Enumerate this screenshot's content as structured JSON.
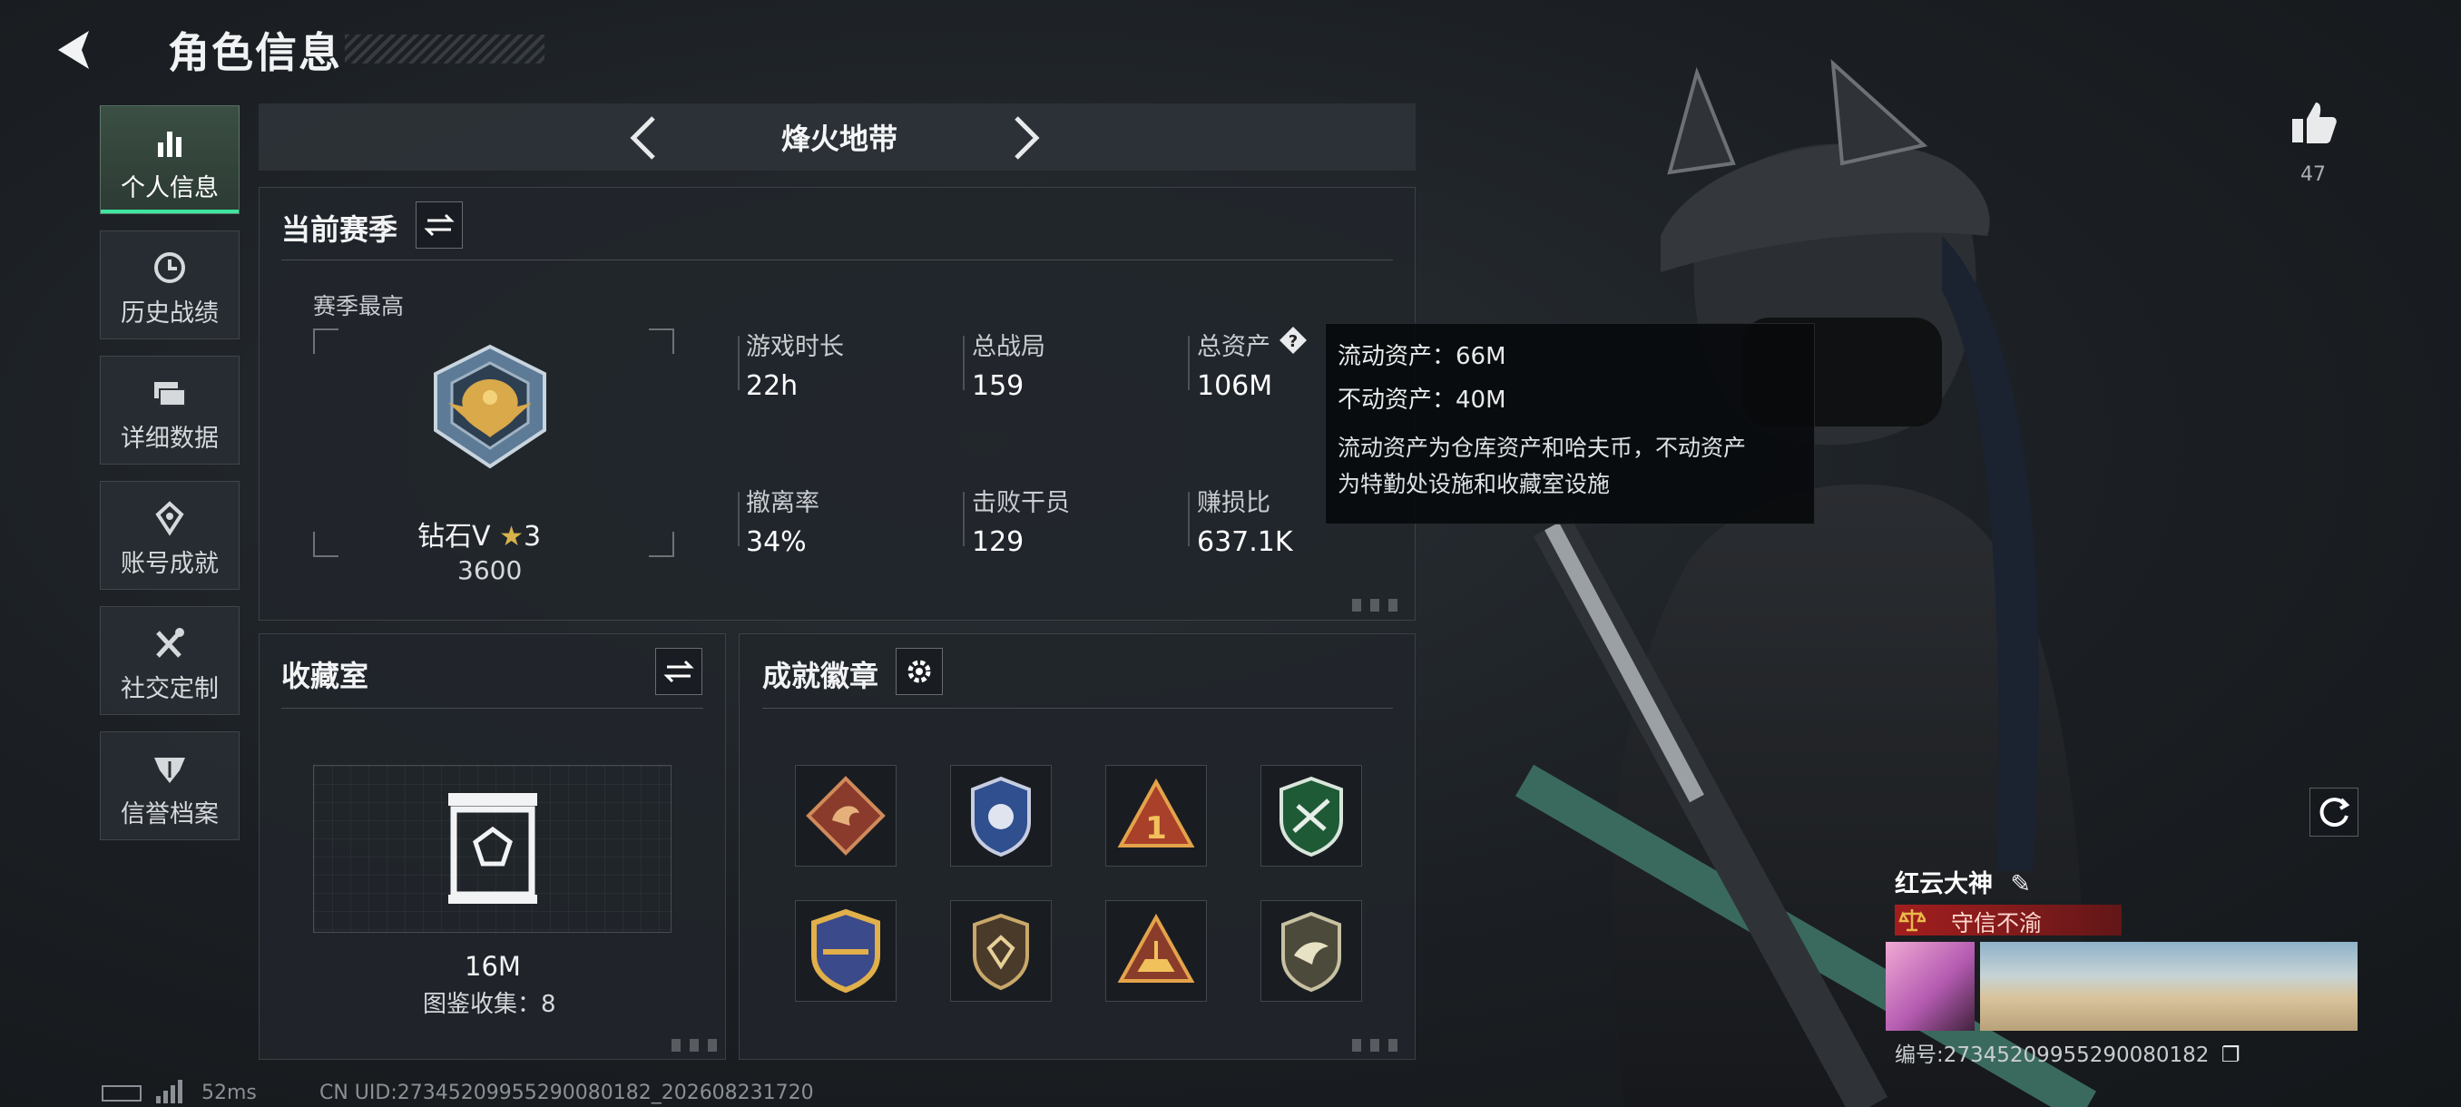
{
  "header": {
    "title": "角色信息"
  },
  "sidebar": {
    "items": [
      {
        "label": "个人信息",
        "icon": "bar-chart-icon",
        "active": true
      },
      {
        "label": "历史战绩",
        "icon": "clock-icon",
        "active": false
      },
      {
        "label": "详细数据",
        "icon": "folders-icon",
        "active": false
      },
      {
        "label": "账号成就",
        "icon": "achievement-icon",
        "active": false
      },
      {
        "label": "社交定制",
        "icon": "tools-icon",
        "active": false
      },
      {
        "label": "信誉档案",
        "icon": "shield-wings-icon",
        "active": false
      }
    ]
  },
  "mode": {
    "title": "烽火地带"
  },
  "season": {
    "title": "当前赛季",
    "best_label": "赛季最高",
    "rank_name": "钻石V",
    "rank_stars": "3",
    "rank_score": "3600",
    "stats": [
      {
        "label": "游戏时长",
        "value": "22h"
      },
      {
        "label": "总战局",
        "value": "159"
      },
      {
        "label": "总资产",
        "value": "106M"
      },
      {
        "label": "撤离率",
        "value": "34%"
      },
      {
        "label": "击败干员",
        "value": "129"
      },
      {
        "label": "赚损比",
        "value": "637.1K"
      }
    ]
  },
  "tooltip": {
    "liquid": "流动资产：66M",
    "fixed": "不动资产：40M",
    "desc_line1": "流动资产为仓库资产和哈夫币，不动资产",
    "desc_line2": "为特勤处设施和收藏室设施"
  },
  "collection": {
    "title": "收藏室",
    "value": "16M",
    "catalog": "图鉴收集：8"
  },
  "achievements": {
    "title": "成就徽章",
    "badges": [
      "dragon-badge-icon",
      "police-badge-icon",
      "triangle-one-badge-icon",
      "green-shield-badge-icon",
      "gold-shield-badge-icon",
      "gem-shield-badge-icon",
      "ship-triangle-badge-icon",
      "bird-badge-icon"
    ]
  },
  "likes": {
    "count": "47"
  },
  "player": {
    "name": "红云大神",
    "title": "守信不渝",
    "id": "编号:27345209955290080182"
  },
  "footer": {
    "ping": "52ms",
    "uid": "CN UID:27345209955290080182_202608231720"
  },
  "colors": {
    "accent": "#3ee6a0",
    "title_badge": "#aa1e1e",
    "panel": "#21262b"
  }
}
